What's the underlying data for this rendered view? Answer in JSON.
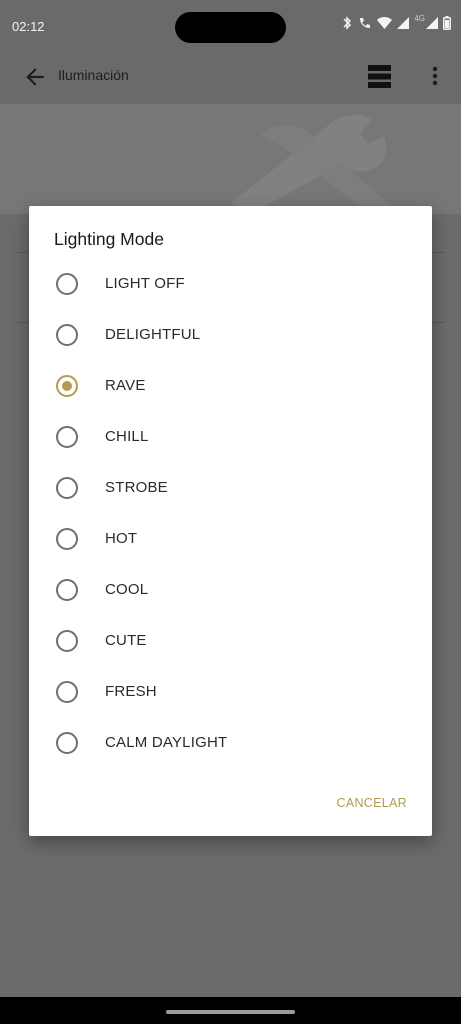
{
  "status_bar": {
    "time": "02:12",
    "network_label": "4G",
    "icons": [
      "bluetooth-icon",
      "wifi-calling-icon",
      "wifi-icon",
      "signal-icon",
      "signal-icon",
      "battery-icon"
    ]
  },
  "app_bar": {
    "title": "Iluminación",
    "back_icon": "arrow-left-icon",
    "layout_icon": "view-agenda-icon",
    "more_icon": "more-vert-icon"
  },
  "dialog": {
    "title": "Lighting Mode",
    "options": [
      {
        "label": "LIGHT OFF",
        "selected": false
      },
      {
        "label": "DELIGHTFUL",
        "selected": false
      },
      {
        "label": "RAVE",
        "selected": true
      },
      {
        "label": "CHILL",
        "selected": false
      },
      {
        "label": "STROBE",
        "selected": false
      },
      {
        "label": "HOT",
        "selected": false
      },
      {
        "label": "COOL",
        "selected": false
      },
      {
        "label": "CUTE",
        "selected": false
      },
      {
        "label": "FRESH",
        "selected": false
      },
      {
        "label": "CALM DAYLIGHT",
        "selected": false
      }
    ],
    "cancel_label": "CANCELAR"
  },
  "colors": {
    "accent": "#b59a4f",
    "scrim": "#6b6b6b",
    "dialog_bg": "#ffffff"
  }
}
